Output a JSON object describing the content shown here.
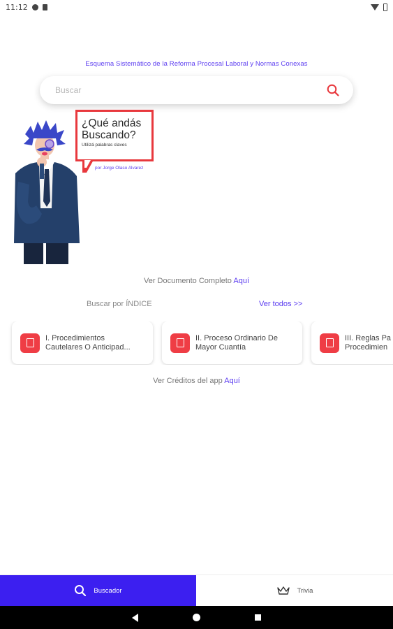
{
  "status_bar": {
    "time": "11:12"
  },
  "header": {
    "subtitle": "Esquema Sistemático de la Reforma Procesal Laboral y Normas Conexas"
  },
  "search": {
    "placeholder": "Buscar"
  },
  "bubble": {
    "title_line1": "¿Qué andás",
    "title_line2": "Buscando?",
    "hint": "Utilizá palabras claves",
    "author": "por Jorge Olaso Alvarez"
  },
  "document_link": {
    "text": "Ver Documento Completo ",
    "link": "Aquí"
  },
  "index": {
    "label": "Buscar por ÍNDICE",
    "see_all": "Ver todos >>"
  },
  "cards": [
    {
      "line1": "I. Procedimientos",
      "line2": "Cautelares O Anticipad..."
    },
    {
      "line1": "II. Proceso Ordinario De",
      "line2": "Mayor Cuantía"
    },
    {
      "line1": "III. Reglas Pa",
      "line2": "Procedimien"
    }
  ],
  "credits": {
    "text": "Ver Créditos del app ",
    "link": "Aquí"
  },
  "bottom_nav": [
    {
      "label": "Buscador",
      "active": true,
      "icon": "search-icon"
    },
    {
      "label": "Trivia",
      "active": false,
      "icon": "crown-icon"
    }
  ],
  "colors": {
    "accent": "#5b3cf0",
    "nav_active": "#3c1ff0",
    "brand_red": "#ef3d45"
  }
}
